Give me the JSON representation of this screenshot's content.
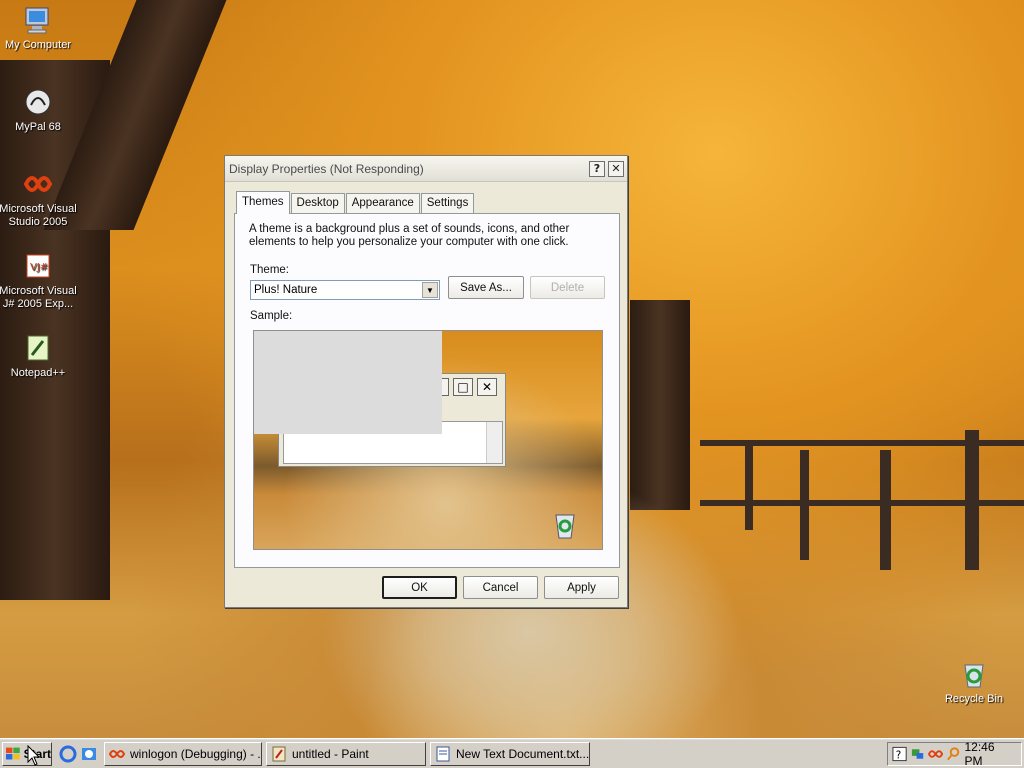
{
  "desktop": {
    "icons": [
      {
        "label": "My Computer",
        "icon": "my-computer-icon"
      },
      {
        "label": "MyPal 68",
        "icon": "mypal-icon"
      },
      {
        "label": "Microsoft Visual Studio 2005",
        "icon": "visual-studio-icon"
      },
      {
        "label": "Microsoft Visual J# 2005 Exp...",
        "icon": "vjsharp-icon"
      },
      {
        "label": "Notepad++",
        "icon": "notepadpp-icon"
      },
      {
        "label": "Recycle Bin",
        "icon": "recycle-bin-icon"
      }
    ]
  },
  "dialog": {
    "title": "Display Properties (Not Responding)",
    "help_glyph": "?",
    "close_glyph": "✕",
    "tabs": [
      {
        "label": "Themes",
        "active": true
      },
      {
        "label": "Desktop",
        "active": false
      },
      {
        "label": "Appearance",
        "active": false
      },
      {
        "label": "Settings",
        "active": false
      }
    ],
    "description": "A theme is a background plus a set of sounds, icons, and other elements to help you personalize your computer with one click.",
    "theme_label": "Theme:",
    "theme_value": "Plus! Nature",
    "save_as_label": "Save As...",
    "delete_label": "Delete",
    "sample_label": "Sample:",
    "ok_label": "OK",
    "cancel_label": "Cancel",
    "apply_label": "Apply"
  },
  "taskbar": {
    "start_label": "Start",
    "tasks": [
      {
        "label": "winlogon (Debugging) - ...",
        "icon": "visual-studio-icon"
      },
      {
        "label": "untitled - Paint",
        "icon": "paint-icon"
      },
      {
        "label": "New Text Document.txt...",
        "icon": "notepad-icon"
      }
    ],
    "clock": "12:46 PM"
  },
  "colors": {
    "dialog_bg": "#ece9d8",
    "taskbar_bg": "#d4d0c8",
    "desktop_leaves": "#e39420"
  }
}
